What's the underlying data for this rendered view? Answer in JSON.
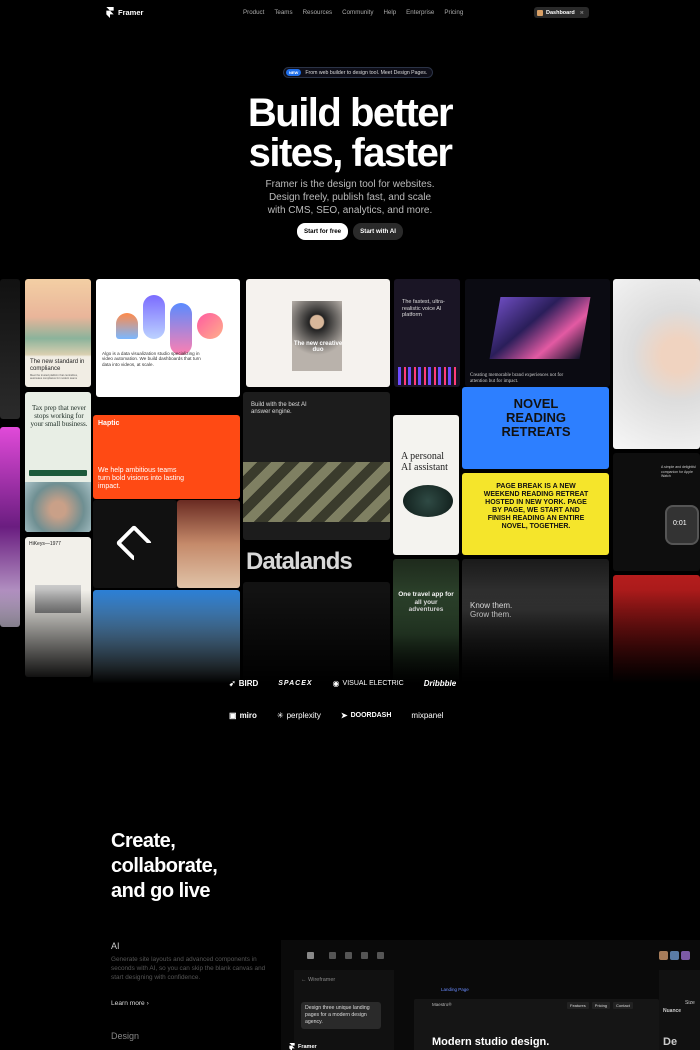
{
  "nav": {
    "brand": "Framer",
    "links": [
      "Product",
      "Teams",
      "Resources",
      "Community",
      "Help",
      "Enterprise",
      "Pricing"
    ],
    "dashboard_label": "Dashboard",
    "dashboard_kbd": "⌘"
  },
  "hero": {
    "badge_new": "NEW",
    "badge_text": "From web builder to design tool. Meet Design Pages.",
    "headline_line1": "Build better",
    "headline_line2": "sites, faster",
    "subtitle_line1": "Framer is the design tool for websites.",
    "subtitle_line2": "Design freely, publish fast, and scale",
    "subtitle_line3": "with CMS, SEO, analytics, and more.",
    "cta_primary": "Start for free",
    "cta_secondary": "Start with AI"
  },
  "showcase": {
    "tiles": [
      {
        "label": "The new standard in compliance",
        "sub": "Meet the trusted platform that centralizes, automates compliance for modern teams"
      },
      {
        "label": "Algo is a data visualization studio specializing in video automation. We build dashboards that turn data into videos, at scale."
      },
      {
        "label": "The new creative duo"
      },
      {
        "label": "The fastest, ultra-realistic voice AI platform"
      },
      {
        "label": "Creating memorable brand experiences not for attention but for impact."
      },
      {
        "label": "Tax prep that never stops working for your small business."
      },
      {
        "label": "Haptic",
        "sub": "We help ambitious teams turn bold visions into lasting impact."
      },
      {
        "label": "Build with the best AI answer engine."
      },
      {
        "label": "A personal AI assistant"
      },
      {
        "label": "NOVEL READING RETREATS"
      },
      {
        "label": "PAGE BREAK IS A NEW WEEKEND READING RETREAT HOSTED IN NEW YORK. PAGE BY PAGE, WE START AND FINISH READING AN ENTIRE NOVEL, TOGETHER."
      },
      {
        "label": "HiKeys—1977"
      },
      {
        "label": "Datalands"
      },
      {
        "label": "One travel app for all your adventures"
      },
      {
        "label": "Know them. Grow them."
      },
      {
        "label": "A simple and delightful companion for Apple Watch"
      },
      {
        "label": "0:01"
      }
    ]
  },
  "logos": {
    "row1": [
      "BIRD",
      "SPACEX",
      "VISUAL ELECTRIC",
      "Dribbble"
    ],
    "row2": [
      "miro",
      "perplexity",
      "DOORDASH",
      "mixpanel"
    ]
  },
  "section": {
    "title_line1": "Create,",
    "title_line2": "collaborate,",
    "title_line3": "and go live",
    "feature_ai_title": "AI",
    "feature_ai_desc": "Generate site layouts and advanced components in seconds with AI, so you can skip the blank canvas and start designing with confidence.",
    "learn_more": "Learn more",
    "feature_design_title": "Design"
  },
  "editor": {
    "crumb": "Wireframer",
    "page_tab": "Landing Page",
    "prompt": "Design three unique landing pages for a modern design agency.",
    "brand": "Framer",
    "canvas_head": "Maestro®",
    "canvas_nav": [
      "Features",
      "Pricing",
      "Contact"
    ],
    "canvas_title": "Modern studio design.",
    "right_items": [
      "Size",
      "Nuance",
      "De"
    ]
  },
  "colors": {
    "accent_blue": "#1f6feb",
    "haptic_orange": "#ff4a14",
    "retreat_yellow": "#f5e52b",
    "retreat_blue": "#2d7fff"
  }
}
